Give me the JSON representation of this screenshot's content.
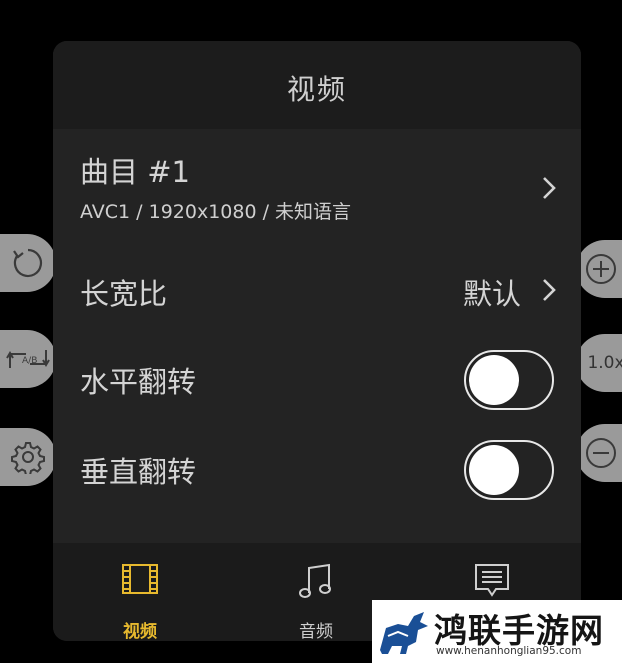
{
  "panel": {
    "title": "视频",
    "track": {
      "title": "曲目 #1",
      "subtitle": "AVC1 / 1920x1080 / 未知语言"
    },
    "aspect": {
      "label": "长宽比",
      "value": "默认"
    },
    "hflip": {
      "label": "水平翻转",
      "enabled": false
    },
    "vflip": {
      "label": "垂直翻转",
      "enabled": false
    }
  },
  "tabs": [
    {
      "label": "视频",
      "icon": "film-icon",
      "active": true,
      "color": "#e7b92e"
    },
    {
      "label": "音频",
      "icon": "music-note-icon",
      "active": false
    },
    {
      "label": "",
      "icon": "subtitle-icon",
      "active": false
    }
  ],
  "side_controls": {
    "left": [
      "rotate-icon",
      "ab-repeat-icon",
      "gear-icon"
    ],
    "right": [
      "zoom-in-icon",
      "speed-icon",
      "zoom-out-icon"
    ],
    "speed": "1.0x"
  },
  "watermark": {
    "title": "鸿联手游网",
    "url": "www.henanhonglian95.com"
  }
}
